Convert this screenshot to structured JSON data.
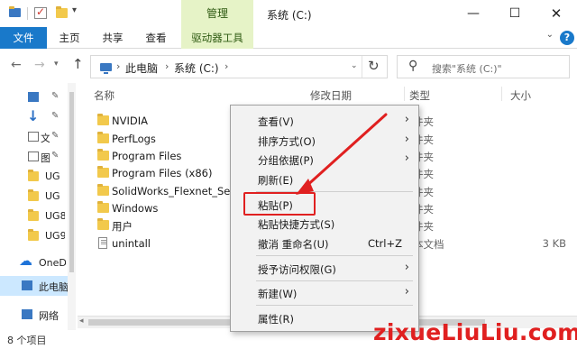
{
  "titlebar": {
    "manage_tab": "管理",
    "window_title": "系统 (C:)",
    "minimize": "—",
    "maximize": "☐",
    "close": "✕"
  },
  "ribbon": {
    "tabs": [
      "文件",
      "主页",
      "共享",
      "查看",
      "驱动器工具"
    ],
    "expand_icon": "chevron-down-icon",
    "help": "?"
  },
  "address": {
    "crumbs": [
      "此电脑",
      "系统 (C:)"
    ],
    "search_placeholder": "搜索\"系统 (C:)\""
  },
  "navpane": {
    "items": [
      {
        "label": "",
        "icon": "desktop-icon"
      },
      {
        "label": "",
        "icon": "download-icon"
      },
      {
        "label": "文",
        "icon": "document-icon"
      },
      {
        "label": "图",
        "icon": "picture-icon"
      },
      {
        "label": "UG",
        "icon": "folder-icon"
      },
      {
        "label": "UG",
        "icon": "folder-icon"
      },
      {
        "label": "UG8",
        "icon": "folder-icon"
      },
      {
        "label": "UG9",
        "icon": "folder-icon"
      },
      {
        "label": "OneD",
        "icon": "cloud-icon"
      },
      {
        "label": "此电脑",
        "icon": "pc-icon"
      },
      {
        "label": "网络",
        "icon": "network-icon"
      }
    ]
  },
  "filelist": {
    "headers": {
      "name": "名称",
      "date": "修改日期",
      "type": "类型",
      "size": "大小"
    },
    "rows": [
      {
        "name": "NVIDIA",
        "type": "件夹",
        "size": "",
        "icon": "folder-icon"
      },
      {
        "name": "PerfLogs",
        "type": "件夹",
        "size": "",
        "icon": "folder-icon"
      },
      {
        "name": "Program Files",
        "type": "件夹",
        "size": "",
        "icon": "folder-icon"
      },
      {
        "name": "Program Files (x86)",
        "type": "件夹",
        "size": "",
        "icon": "folder-icon"
      },
      {
        "name": "SolidWorks_Flexnet_Server",
        "type": "件夹",
        "size": "",
        "icon": "folder-icon"
      },
      {
        "name": "Windows",
        "type": "件夹",
        "size": "",
        "icon": "folder-icon"
      },
      {
        "name": "用户",
        "type": "件夹",
        "size": "",
        "icon": "folder-icon"
      },
      {
        "name": "unintall",
        "type": "本文档",
        "size": "3 KB",
        "icon": "text-file-icon"
      }
    ]
  },
  "context_menu": {
    "items": [
      {
        "label": "查看(V)",
        "shortcut": "",
        "submenu": true
      },
      {
        "label": "排序方式(O)",
        "shortcut": "",
        "submenu": true
      },
      {
        "label": "分组依据(P)",
        "shortcut": "",
        "submenu": true
      },
      {
        "label": "刷新(E)",
        "shortcut": "",
        "submenu": false
      },
      {
        "label": "粘贴(P)",
        "shortcut": "",
        "submenu": false
      },
      {
        "label": "粘贴快捷方式(S)",
        "shortcut": "",
        "submenu": false
      },
      {
        "label": "撤消 重命名(U)",
        "shortcut": "Ctrl+Z",
        "submenu": false
      },
      {
        "label": "授予访问权限(G)",
        "shortcut": "",
        "submenu": true
      },
      {
        "label": "新建(W)",
        "shortcut": "",
        "submenu": true
      },
      {
        "label": "属性(R)",
        "shortcut": "",
        "submenu": false
      }
    ]
  },
  "status": {
    "count": "8 个项目"
  },
  "watermark": "zixueLiuLiu.com",
  "colors": {
    "accent": "#1979ca",
    "manage_bg": "#e6f3c7",
    "annotation": "#e02020"
  }
}
